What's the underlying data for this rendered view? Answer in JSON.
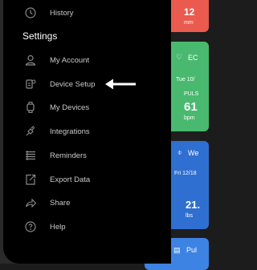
{
  "history_label": "History",
  "settings_title": "Settings",
  "menu": [
    {
      "label": "My Account",
      "icon": "user-icon"
    },
    {
      "label": "Device Setup",
      "icon": "device-setup-icon"
    },
    {
      "label": "My Devices",
      "icon": "watch-icon"
    },
    {
      "label": "Integrations",
      "icon": "plug-icon"
    },
    {
      "label": "Reminders",
      "icon": "list-icon"
    },
    {
      "label": "Export Data",
      "icon": "export-icon"
    },
    {
      "label": "Share",
      "icon": "share-icon"
    },
    {
      "label": "Help",
      "icon": "help-icon"
    }
  ],
  "cards": {
    "red": {
      "value": "12",
      "unit": "mm",
      "color": "#ea5a4f"
    },
    "green": {
      "title": "EC",
      "date": "Tue 10/",
      "pulse_label": "PULS",
      "pulse_value": "61",
      "pulse_unit": "bpm",
      "color": "#49b96f"
    },
    "blue": {
      "title": "We",
      "date": "Fri 12/18",
      "value": "21.",
      "unit": "lbs",
      "color": "#2f6fd1"
    },
    "blue2": {
      "title": "Pul",
      "color": "#3d83e3"
    }
  }
}
